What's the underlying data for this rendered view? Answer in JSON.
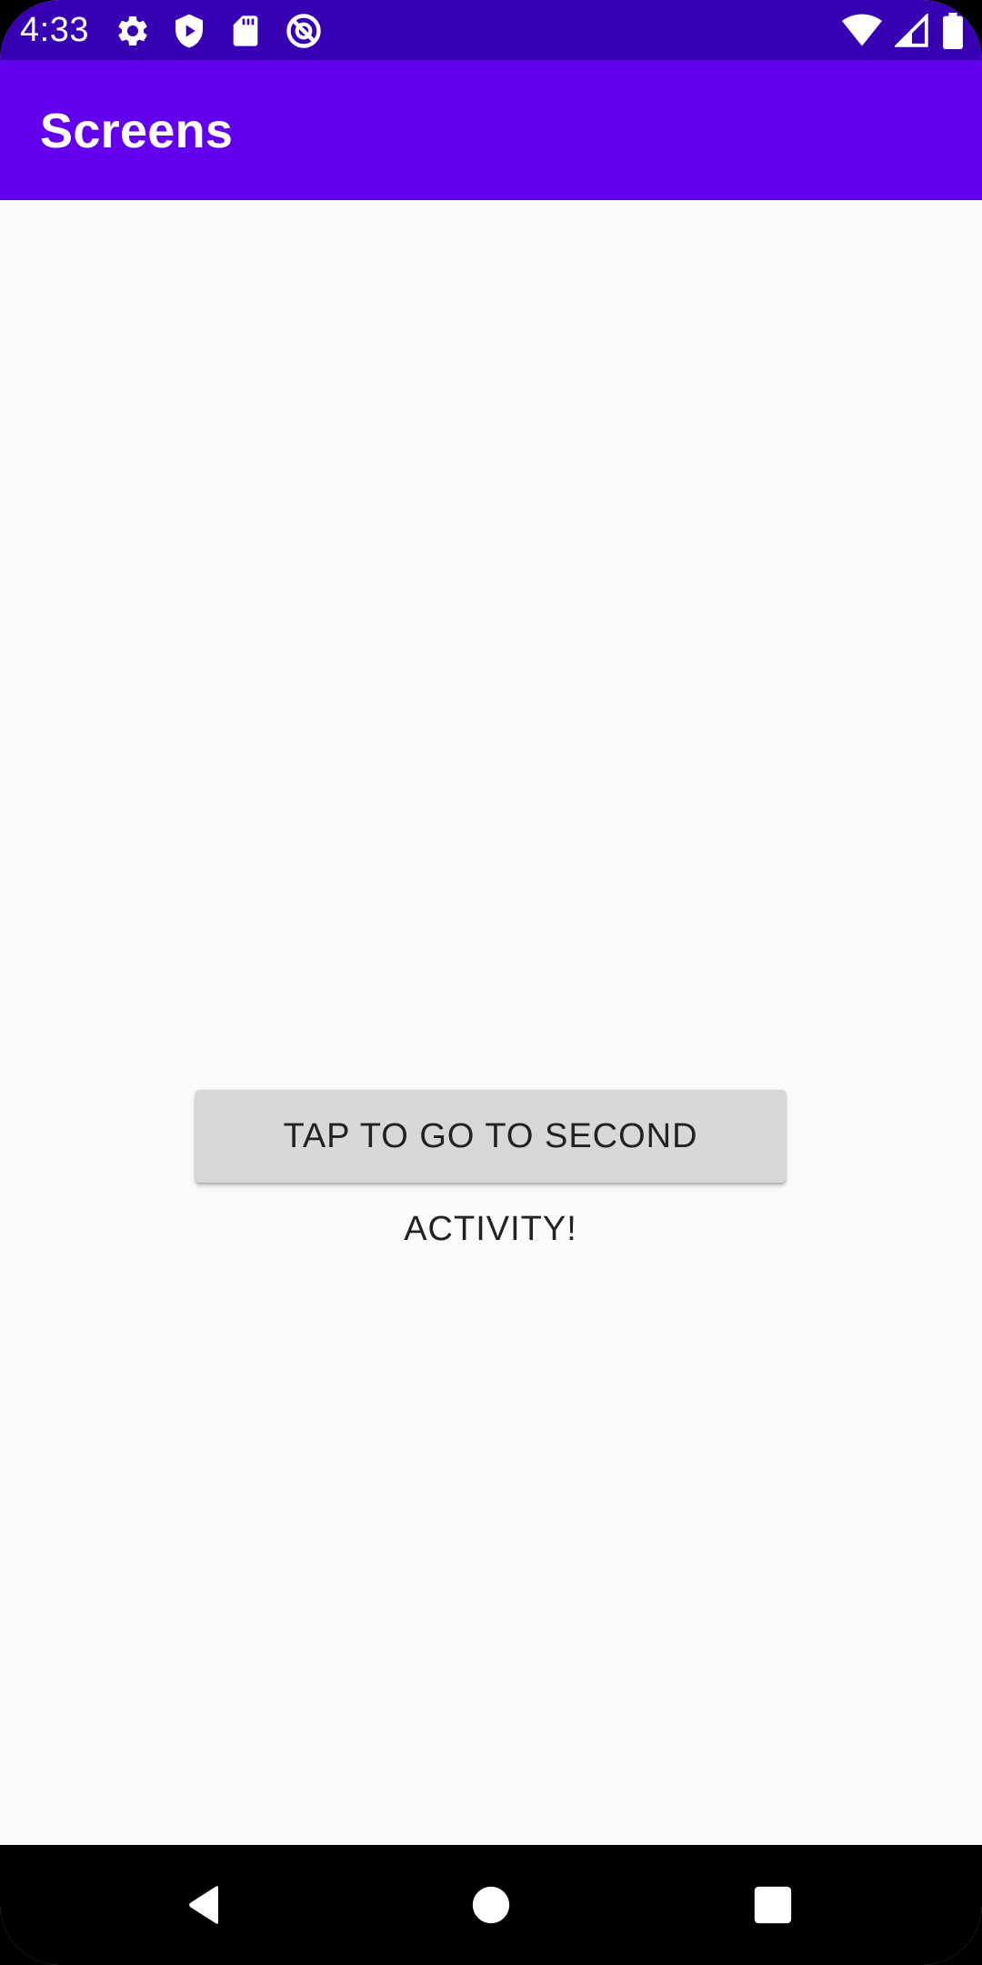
{
  "status_bar": {
    "time": "4:33",
    "background": "#3700b3",
    "left_icons": [
      "settings-gear-icon",
      "shield-play-icon",
      "sd-card-icon",
      "no-sync-icon"
    ],
    "right_icons": [
      "wifi-icon",
      "cell-signal-icon",
      "battery-icon"
    ]
  },
  "app_bar": {
    "title": "Screens",
    "background": "#6200ee"
  },
  "main": {
    "button_label": "TAP TO GO TO SECOND ACTIVITY!",
    "background": "#fafafa"
  },
  "nav_bar": {
    "buttons": [
      "back-icon",
      "home-icon",
      "recents-icon"
    ]
  }
}
